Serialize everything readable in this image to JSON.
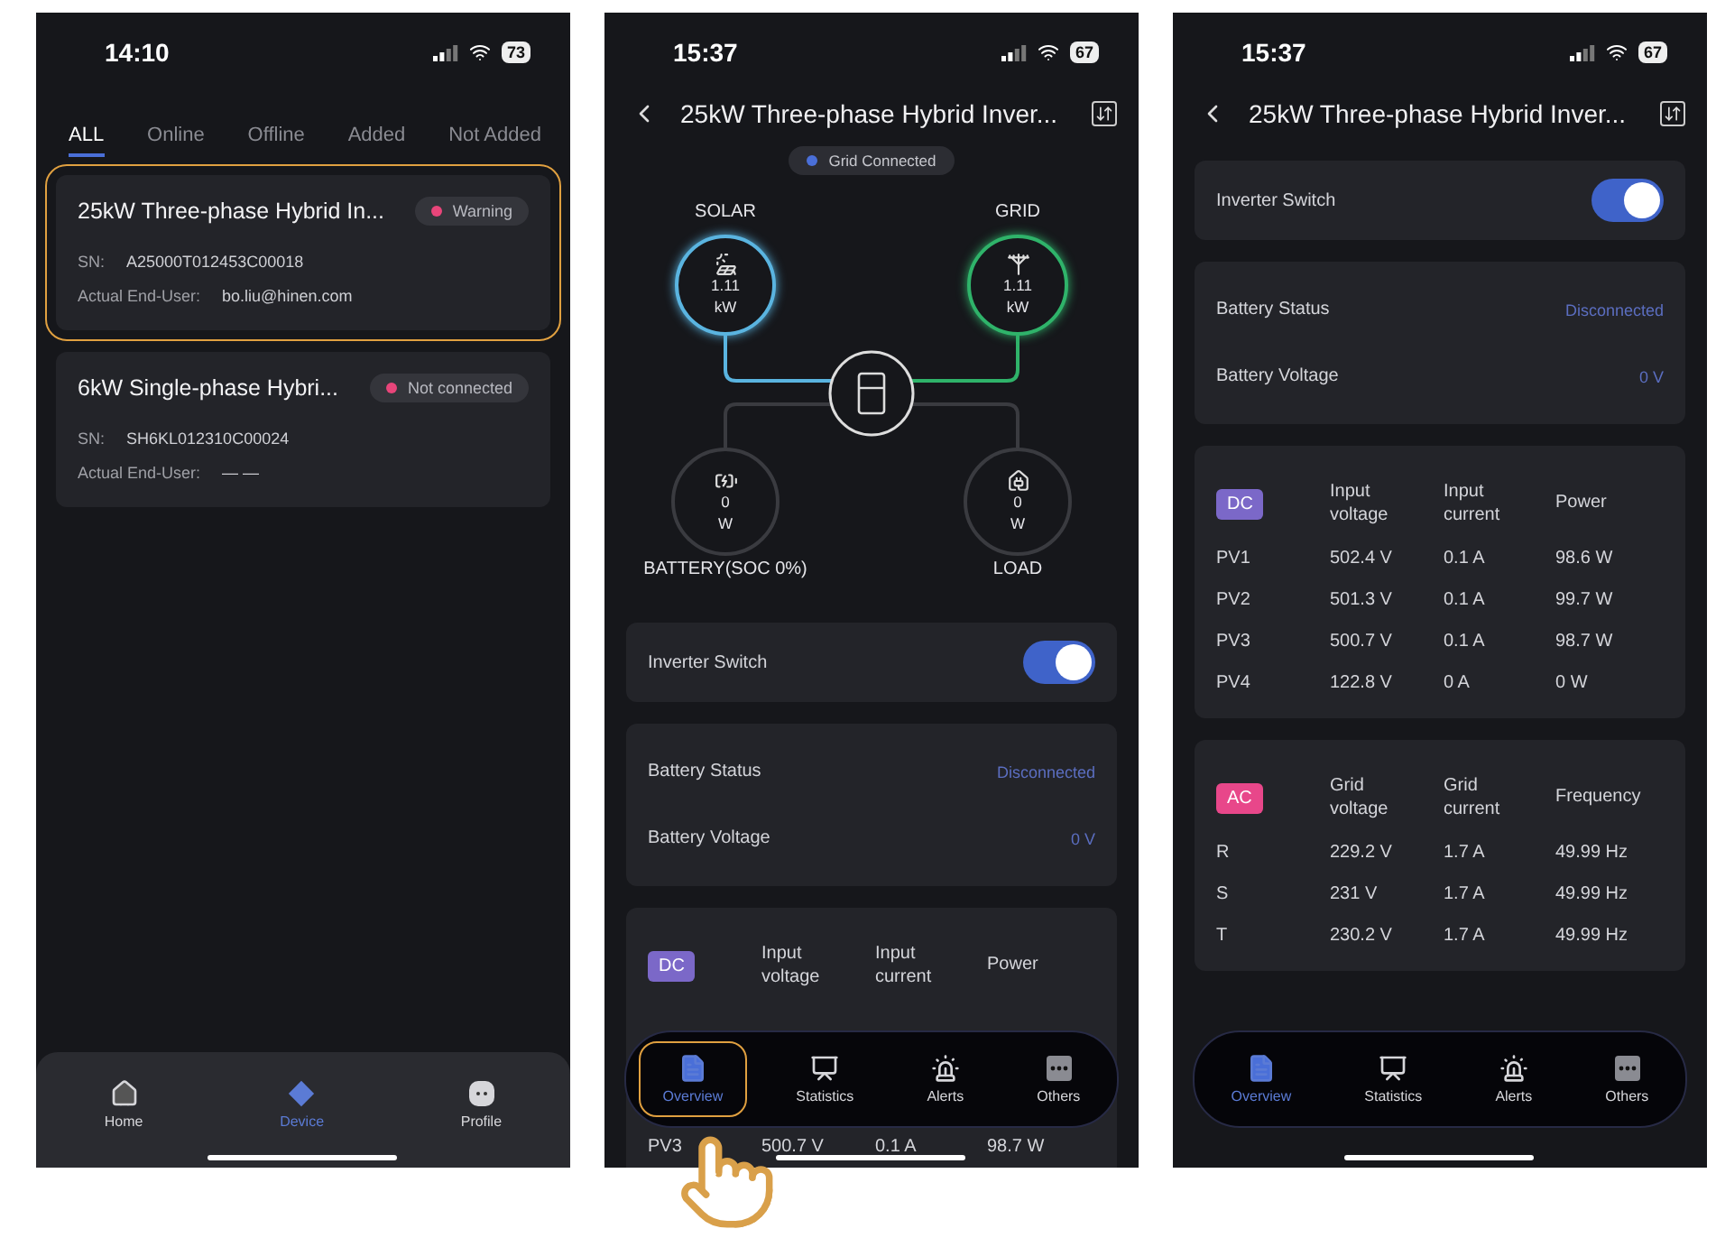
{
  "screens": [
    {
      "kind": "device_list",
      "time": "14:10",
      "battery": "73",
      "tabs": [
        {
          "label": "ALL",
          "selected": true
        },
        {
          "label": "Online",
          "selected": false
        },
        {
          "label": "Offline",
          "selected": false
        },
        {
          "label": "Added",
          "selected": false
        },
        {
          "label": "Not Added",
          "selected": false
        }
      ],
      "devices": [
        {
          "name": "25kW Three-phase Hybrid In...",
          "status": "Warning",
          "color": "#e8457a",
          "highlighted": true,
          "fields": [
            {
              "label": "SN:",
              "value": "A25000T012453C00018"
            },
            {
              "label": "Actual End-User:",
              "value": "bo.liu@hinen.com"
            }
          ]
        },
        {
          "name": "6kW Single-phase Hybri...",
          "status": "Not connected",
          "color": "#e8457a",
          "highlighted": false,
          "fields": [
            {
              "label": "SN:",
              "value": "SH6KL012310C00024"
            },
            {
              "label": "Actual End-User:",
              "value": "— —"
            }
          ]
        }
      ],
      "nav": [
        {
          "kind": "home",
          "label": "Home",
          "selected": false,
          "highlighted": false
        },
        {
          "kind": "device",
          "label": "Device",
          "selected": true,
          "highlighted": false
        },
        {
          "kind": "profile",
          "label": "Profile",
          "selected": false,
          "highlighted": false
        }
      ]
    },
    {
      "kind": "detail_overview",
      "time": "15:37",
      "battery": "67",
      "title": "25kW Three-phase Hybrid Inver...",
      "grid_status": {
        "label": "Grid Connected",
        "color": "#4a6fd8"
      },
      "nodes": [
        {
          "kind": "solar",
          "label": "SOLAR",
          "value": "1.11",
          "unit": "kW",
          "color": "#5ab4e0"
        },
        {
          "kind": "grid",
          "label": "GRID",
          "value": "1.11",
          "unit": "kW",
          "color": "#2fb36a"
        },
        {
          "kind": "battery",
          "label": "BATTERY(SOC 0%)",
          "value": "0",
          "unit": "W",
          "color": "#3a3b40"
        },
        {
          "kind": "load",
          "label": "LOAD",
          "value": "0",
          "unit": "W",
          "color": "#3a3b40"
        }
      ],
      "switch": {
        "label": "Inverter Switch",
        "on": true
      },
      "battery_info": [
        {
          "label": "Battery Status",
          "value": "Disconnected"
        },
        {
          "label": "Battery Voltage",
          "value": "0 V"
        }
      ],
      "tables": [
        {
          "tag": "DC",
          "color": "#7b68c8",
          "columns": [
            "Input voltage",
            "Input current",
            "Power"
          ],
          "rows": [
            {
              "label": "PV3",
              "values": [
                "500.7 V",
                "0.1 A",
                "98.7 W"
              ]
            }
          ]
        }
      ],
      "nav": [
        {
          "kind": "overview",
          "label": "Overview",
          "selected": true,
          "highlighted": true
        },
        {
          "kind": "statistics",
          "label": "Statistics",
          "selected": false,
          "highlighted": false
        },
        {
          "kind": "alerts",
          "label": "Alerts",
          "selected": false,
          "highlighted": false
        },
        {
          "kind": "others",
          "label": "Others",
          "selected": false,
          "highlighted": false
        }
      ]
    },
    {
      "kind": "detail_data",
      "time": "15:37",
      "battery": "67",
      "title": "25kW Three-phase Hybrid Inver...",
      "switch": {
        "label": "Inverter Switch",
        "on": true
      },
      "battery_info": [
        {
          "label": "Battery Status",
          "value": "Disconnected"
        },
        {
          "label": "Battery Voltage",
          "value": "0 V"
        }
      ],
      "tables": [
        {
          "tag": "DC",
          "color": "#7b68c8",
          "columns": [
            "Input voltage",
            "Input current",
            "Power"
          ],
          "rows": [
            {
              "label": "PV1",
              "values": [
                "502.4 V",
                "0.1 A",
                "98.6 W"
              ]
            },
            {
              "label": "PV2",
              "values": [
                "501.3 V",
                "0.1 A",
                "99.7 W"
              ]
            },
            {
              "label": "PV3",
              "values": [
                "500.7 V",
                "0.1 A",
                "98.7 W"
              ]
            },
            {
              "label": "PV4",
              "values": [
                "122.8 V",
                "0 A",
                "0 W"
              ]
            }
          ]
        },
        {
          "tag": "AC",
          "color": "#e8478a",
          "columns": [
            "Grid voltage",
            "Grid current",
            "Frequency"
          ],
          "rows": [
            {
              "label": "R",
              "values": [
                "229.2 V",
                "1.7 A",
                "49.99 Hz"
              ]
            },
            {
              "label": "S",
              "values": [
                "231 V",
                "1.7 A",
                "49.99 Hz"
              ]
            },
            {
              "label": "T",
              "values": [
                "230.2 V",
                "1.7 A",
                "49.99 Hz"
              ]
            }
          ]
        }
      ],
      "nav": [
        {
          "kind": "overview",
          "label": "Overview",
          "selected": true,
          "highlighted": false
        },
        {
          "kind": "statistics",
          "label": "Statistics",
          "selected": false,
          "highlighted": false
        },
        {
          "kind": "alerts",
          "label": "Alerts",
          "selected": false,
          "highlighted": false
        },
        {
          "kind": "others",
          "label": "Others",
          "selected": false,
          "highlighted": false
        }
      ]
    }
  ]
}
